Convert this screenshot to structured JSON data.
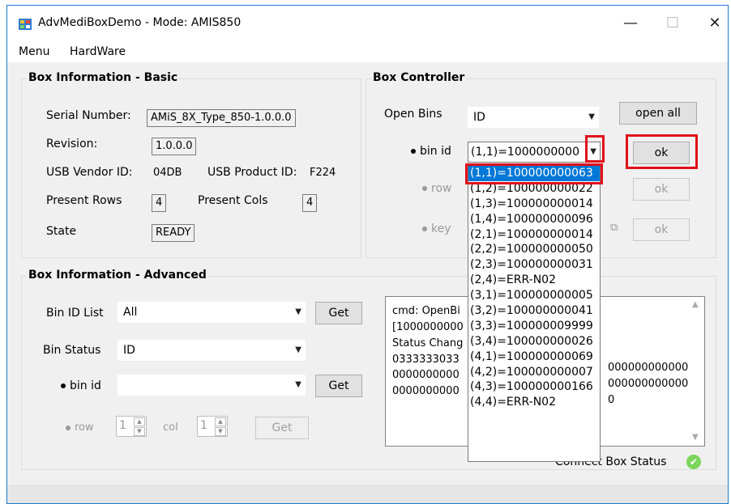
{
  "window": {
    "title": "AdvMediBoxDemo - Mode: AMIS850",
    "min_glyph": "—",
    "max_glyph": "☐",
    "close_glyph": "✕"
  },
  "menu": [
    "Menu",
    "HardWare"
  ],
  "basic": {
    "title": "Box Information - Basic",
    "serial_label": "Serial Number:",
    "serial_value": "AMiS_8X_Type_850-1.0.0.0",
    "revision_label": "Revision:",
    "revision_value": "1.0.0.0",
    "vendor_label": "USB Vendor ID:",
    "vendor_value": "04DB",
    "product_label": "USB Product ID:",
    "product_value": "F224",
    "rows_label": "Present Rows",
    "rows_value": "4",
    "cols_label": "Present Cols",
    "cols_value": "4",
    "state_label": "State",
    "state_value": "READY"
  },
  "controller": {
    "title": "Box Controller",
    "open_bins_label": "Open Bins",
    "open_bins_value": "ID",
    "open_all_label": "open all",
    "bin_id_label": "bin id",
    "bin_id_value": "(1,1)=1000000000",
    "ok_label": "ok",
    "row_label": "row",
    "key_label": "key"
  },
  "dropdown": [
    "(1,1)=100000000063",
    "(1,2)=100000000022",
    "(1,3)=100000000014",
    "(1,4)=100000000096",
    "(2,1)=100000000014",
    "(2,2)=100000000050",
    "(2,3)=100000000031",
    "(2,4)=ERR-N02",
    "(3,1)=100000000005",
    "(3,2)=100000000041",
    "(3,3)=100000009999",
    "(3,4)=100000000026",
    "(4,1)=100000000069",
    "(4,2)=100000000007",
    "(4,3)=100000000166",
    "(4,4)=ERR-N02"
  ],
  "advanced": {
    "title": "Box Information - Advanced",
    "bin_id_list_label": "Bin ID List",
    "bin_id_list_value": "All",
    "get_label": "Get",
    "bin_status_label": "Bin Status",
    "bin_status_value": "ID",
    "bin_id_label": "bin id",
    "bin_id_value": "",
    "row_label": "row",
    "row_value": "1",
    "col_label": "col",
    "col_value": "1"
  },
  "log": {
    "line1": "cmd: OpenBi",
    "line2": "[1000000000",
    "line3": "Status Chang",
    "line4a": "0333333033",
    "line4b": "000000000000",
    "line5a": "0000000000",
    "line5b": "000000000000",
    "line6a": "0000000000",
    "line6b": "0"
  },
  "connect_status_label": "Connect Box Status",
  "colors": {
    "accent": "#0078d7",
    "highlight": "#e0101a",
    "ok_green": "#7bd55b"
  }
}
